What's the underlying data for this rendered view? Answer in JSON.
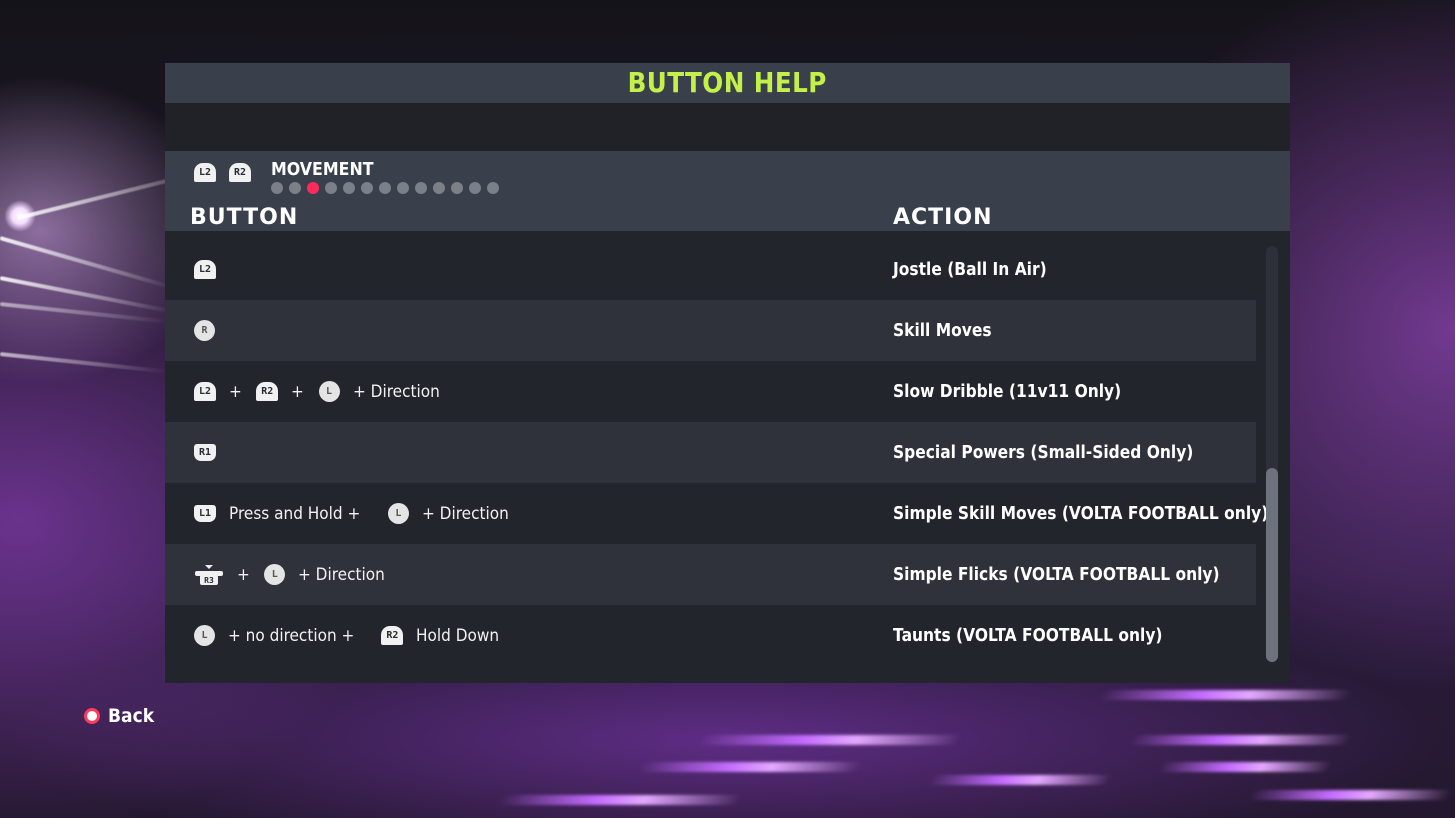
{
  "title": "BUTTON HELP",
  "section": {
    "title": "MOVEMENT",
    "prev_button": "L2",
    "next_button": "R2",
    "page_count": 13,
    "active_page": 3
  },
  "columns": {
    "button": "BUTTON",
    "action": "ACTION"
  },
  "rows": [
    {
      "sequence": [
        {
          "type": "trigger",
          "label": "L2"
        }
      ],
      "action": "Jostle (Ball In Air)"
    },
    {
      "sequence": [
        {
          "type": "stick",
          "label": "R"
        }
      ],
      "action": "Skill Moves"
    },
    {
      "sequence": [
        {
          "type": "trigger",
          "label": "L2"
        },
        {
          "type": "text",
          "text": "+"
        },
        {
          "type": "trigger",
          "label": "R2"
        },
        {
          "type": "text",
          "text": "+"
        },
        {
          "type": "stick",
          "label": "L"
        },
        {
          "type": "text",
          "text": "+ Direction"
        }
      ],
      "action": "Slow Dribble (11v11 Only)"
    },
    {
      "sequence": [
        {
          "type": "bumper",
          "label": "R1"
        }
      ],
      "action": "Special Powers (Small-Sided Only)"
    },
    {
      "sequence": [
        {
          "type": "bumper",
          "label": "L1"
        },
        {
          "type": "text",
          "text": "Press and Hold +"
        },
        {
          "type": "stick",
          "label": "L"
        },
        {
          "type": "text",
          "text": "+ Direction"
        }
      ],
      "action": "Simple Skill Moves (VOLTA FOOTBALL only)"
    },
    {
      "sequence": [
        {
          "type": "pressstick",
          "label": "R3"
        },
        {
          "type": "text",
          "text": "+"
        },
        {
          "type": "stick",
          "label": "L"
        },
        {
          "type": "text",
          "text": "+ Direction"
        }
      ],
      "action": "Simple Flicks (VOLTA FOOTBALL only)"
    },
    {
      "sequence": [
        {
          "type": "stick",
          "label": "L"
        },
        {
          "type": "text",
          "text": "+ no direction +"
        },
        {
          "type": "trigger",
          "label": "R2"
        },
        {
          "type": "text",
          "text": "Hold Down"
        }
      ],
      "action": "Taunts (VOLTA FOOTBALL only)"
    }
  ],
  "scrollbar": {
    "position_fraction": 1.0
  },
  "back": {
    "label": "Back",
    "icon": "circle-button-icon"
  },
  "colors": {
    "title": "#c4f04a",
    "active_dot": "#ff2a5a",
    "inactive_dot": "#7a7f88",
    "back_circle": "#ff3b5c"
  }
}
